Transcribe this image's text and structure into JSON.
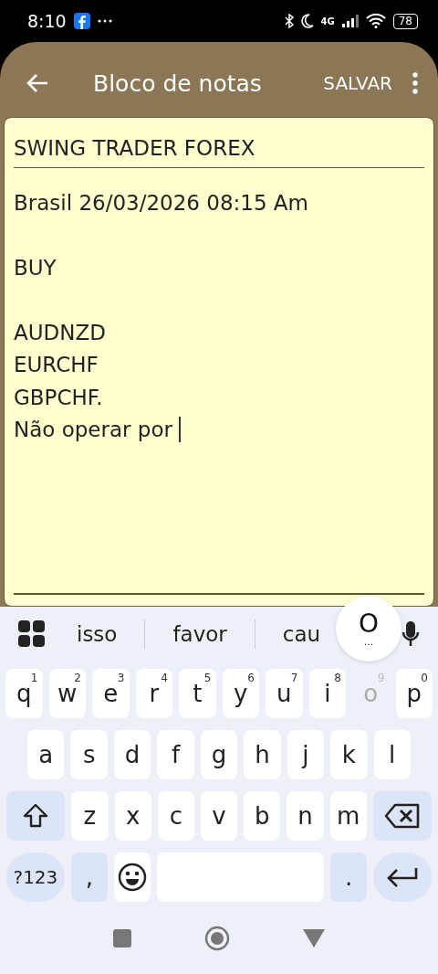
{
  "status_bar": {
    "time": "8:10",
    "network": "4G",
    "battery": "78"
  },
  "app_bar": {
    "title": "Bloco de notas",
    "action": "SALVAR"
  },
  "note": {
    "title": "SWING TRADER FOREX",
    "paragraphs": [
      [
        "Brasil 26/03/2026 08:15 Am"
      ],
      [
        "BUY"
      ],
      [
        "AUDNZD",
        "EURCHF",
        "GBPCHF.",
        "Não operar por "
      ]
    ]
  },
  "keyboard": {
    "suggestions": [
      "isso",
      "favor",
      "cau"
    ],
    "key_preview": {
      "label": "O",
      "more": "..."
    },
    "row1": [
      {
        "label": "q",
        "hint": "1",
        "pressed": false
      },
      {
        "label": "w",
        "hint": "2",
        "pressed": false
      },
      {
        "label": "e",
        "hint": "3",
        "pressed": false
      },
      {
        "label": "r",
        "hint": "4",
        "pressed": false
      },
      {
        "label": "t",
        "hint": "5",
        "pressed": false
      },
      {
        "label": "y",
        "hint": "6",
        "pressed": false
      },
      {
        "label": "u",
        "hint": "7",
        "pressed": false
      },
      {
        "label": "i",
        "hint": "8",
        "pressed": false
      },
      {
        "label": "o",
        "hint": "9",
        "pressed": true
      },
      {
        "label": "p",
        "hint": "0",
        "pressed": false
      }
    ],
    "row2": [
      "a",
      "s",
      "d",
      "f",
      "g",
      "h",
      "j",
      "k",
      "l"
    ],
    "row3": [
      "z",
      "x",
      "c",
      "v",
      "b",
      "n",
      "m"
    ],
    "symbols_key": "?123",
    "comma_key": ",",
    "period_key": "."
  }
}
